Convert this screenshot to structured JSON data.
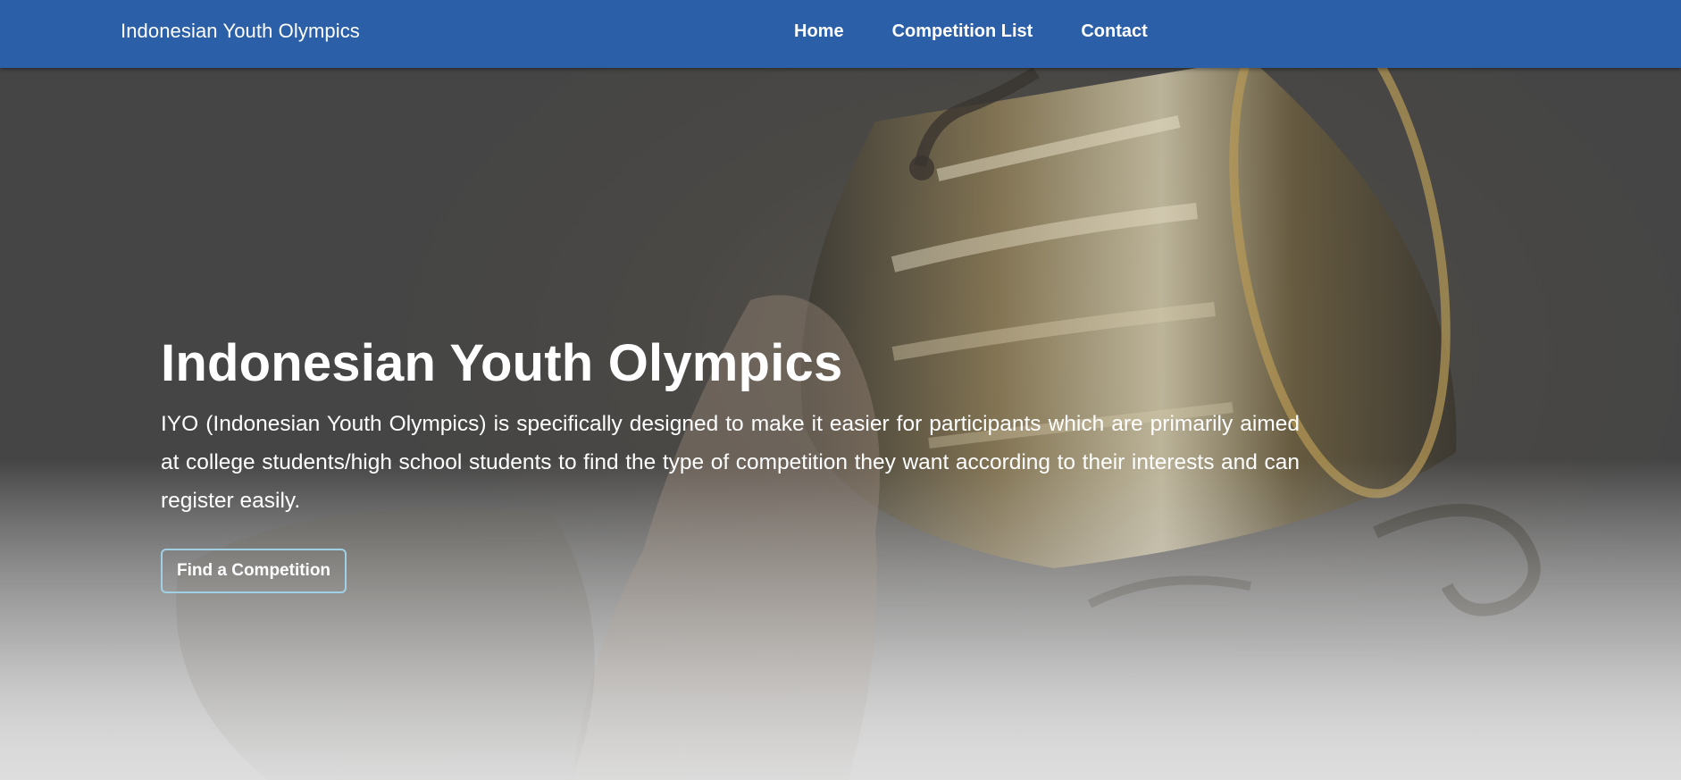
{
  "nav": {
    "brand": "Indonesian Youth Olympics",
    "links": [
      "Home",
      "Competition List",
      "Contact"
    ]
  },
  "hero": {
    "title": "Indonesian Youth Olympics",
    "description": "IYO (Indonesian Youth Olympics) is specifically designed to make it easier for participants which are primarily aimed at college students/high school students to find the type of competition they want according to their interests and can register easily.",
    "cta_label": "Find a Competition"
  },
  "colors": {
    "navbar": "#2b5fa8",
    "cta_border": "#9fd0e6"
  }
}
